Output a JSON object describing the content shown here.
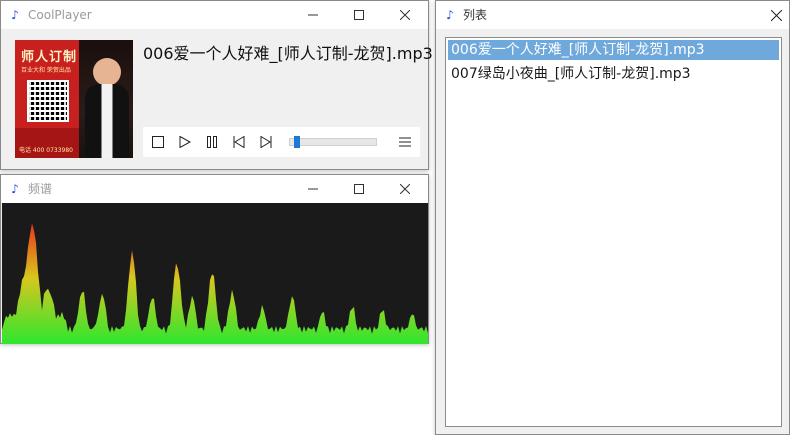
{
  "player": {
    "title": "CoolPlayer",
    "song_title": "006爱一个人好难_[师人订制-龙贺].mp3",
    "progress": 0.05,
    "cover": {
      "line1": "师人订制",
      "line2": "百业大和 荣贺出品",
      "tel": "电话 400 0733980"
    },
    "controls": [
      "stop-icon",
      "play-icon",
      "pause-icon",
      "previous-icon",
      "next-icon",
      "menu-icon"
    ]
  },
  "spectrum": {
    "title": "频谱",
    "colors": {
      "low": "#2ee62e",
      "mid": "#d8c61e",
      "high": "#e8341c",
      "background": "#1a1a1a"
    }
  },
  "playlist": {
    "title": "列表",
    "items": [
      {
        "label": "006爱一个人好难_[师人订制-龙贺].mp3",
        "selected": true
      },
      {
        "label": "007绿岛小夜曲_[师人订制-龙贺].mp3",
        "selected": false
      }
    ]
  }
}
